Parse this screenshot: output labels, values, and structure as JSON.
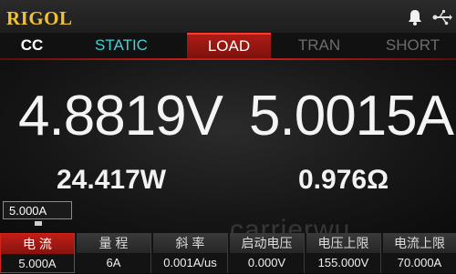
{
  "brand": "RIGOL",
  "header": {
    "bell_icon": "bell-icon",
    "usb_icon": "usb-icon"
  },
  "mode": "CC",
  "tabs": [
    {
      "label": "STATIC",
      "state": "available",
      "color": "#3fd3d6"
    },
    {
      "label": "LOAD",
      "state": "active",
      "color": "#c21d16"
    },
    {
      "label": "TRAN",
      "state": "disabled",
      "color": "#6c6c6c"
    },
    {
      "label": "SHORT",
      "state": "disabled",
      "color": "#6c6c6c"
    }
  ],
  "readings": {
    "voltage": "4.8819V",
    "current": "5.0015A",
    "power": "24.417W",
    "resistance": "0.976Ω"
  },
  "setpoint": "5.000A",
  "watermark": "carrierwu",
  "params": [
    {
      "label": "电 流",
      "value": "5.000A"
    },
    {
      "label": "量 程",
      "value": "6A"
    },
    {
      "label": "斜 率",
      "value": "0.001A/us"
    },
    {
      "label": "启动电压",
      "value": "0.000V"
    },
    {
      "label": "电压上限",
      "value": "155.000V"
    },
    {
      "label": "电流上限",
      "value": "70.000A"
    }
  ]
}
